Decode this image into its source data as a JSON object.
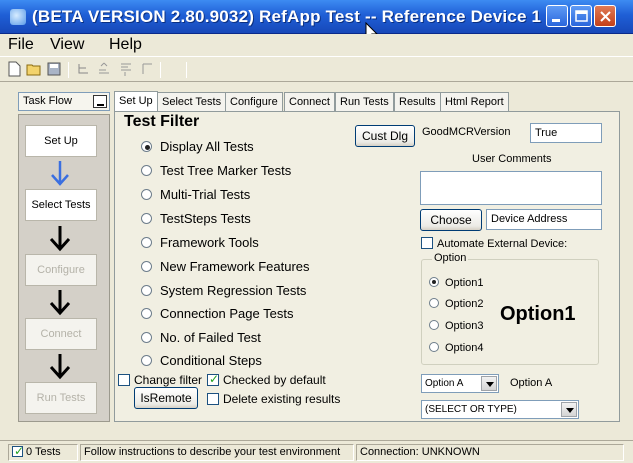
{
  "window": {
    "title": "(BETA VERSION 2.80.9032) RefApp Test -- Reference Device 1",
    "controls": [
      "minimize-icon",
      "maximize-icon",
      "close-icon"
    ],
    "accent_color": "#1f5fd6"
  },
  "menu": {
    "file": "File",
    "view": "View",
    "help": "Help"
  },
  "toolbar": {
    "icons": [
      "new-file-icon",
      "open-folder-icon",
      "save-icon",
      "tree-icon",
      "move-up-icon",
      "move-down-icon",
      "filter-icon"
    ]
  },
  "taskflow": {
    "header": "Task Flow",
    "steps": [
      {
        "label": "Set Up",
        "enabled": true
      },
      {
        "label": "Select Tests",
        "enabled": true
      },
      {
        "label": "Configure",
        "enabled": false
      },
      {
        "label": "Connect",
        "enabled": false
      },
      {
        "label": "Run Tests",
        "enabled": false
      }
    ]
  },
  "tabs": [
    "Set Up",
    "Select Tests",
    "Configure",
    "Connect",
    "Run Tests",
    "Results",
    "Html Report"
  ],
  "active_tab": "Set Up",
  "test_filter": {
    "title": "Test Filter",
    "options": [
      "Display All Tests",
      "Test Tree Marker Tests",
      "Multi-Trial Tests",
      "TestSteps Tests",
      "Framework Tools",
      "New Framework Features",
      "System Regression Tests",
      "Connection Page Tests",
      "No. of Failed Test",
      "Conditional Steps"
    ],
    "selected": "Display All Tests"
  },
  "options_left": {
    "change_filter": "Change filter",
    "change_filter_checked": false,
    "checked_by_default": "Checked by default",
    "checked_by_default_checked": true,
    "is_remote_button": "IsRemote",
    "delete_existing": "Delete existing results",
    "delete_existing_checked": false
  },
  "right": {
    "cust_dlg_button": "Cust Dlg",
    "good_mcr_label": "GoodMCRVersion",
    "good_mcr_value": "True",
    "user_comments_label": "User Comments",
    "user_comments_value": "",
    "choose_button": "Choose",
    "device_address_value": "Device Address",
    "automate_label": "Automate External Device:",
    "automate_checked": false,
    "option_group_label": "Option",
    "options": [
      "Option1",
      "Option2",
      "Option3",
      "Option4"
    ],
    "selected_option": "Option1",
    "big_option_label": "Option1",
    "select_a_value": "Option A",
    "select_a_label": "Option A",
    "select_or_type": "(SELECT OR TYPE)"
  },
  "status": {
    "tests_count": "0 Tests",
    "tests_checked": true,
    "message": "Follow instructions to describe your test environment",
    "connection": "Connection: UNKNOWN"
  }
}
